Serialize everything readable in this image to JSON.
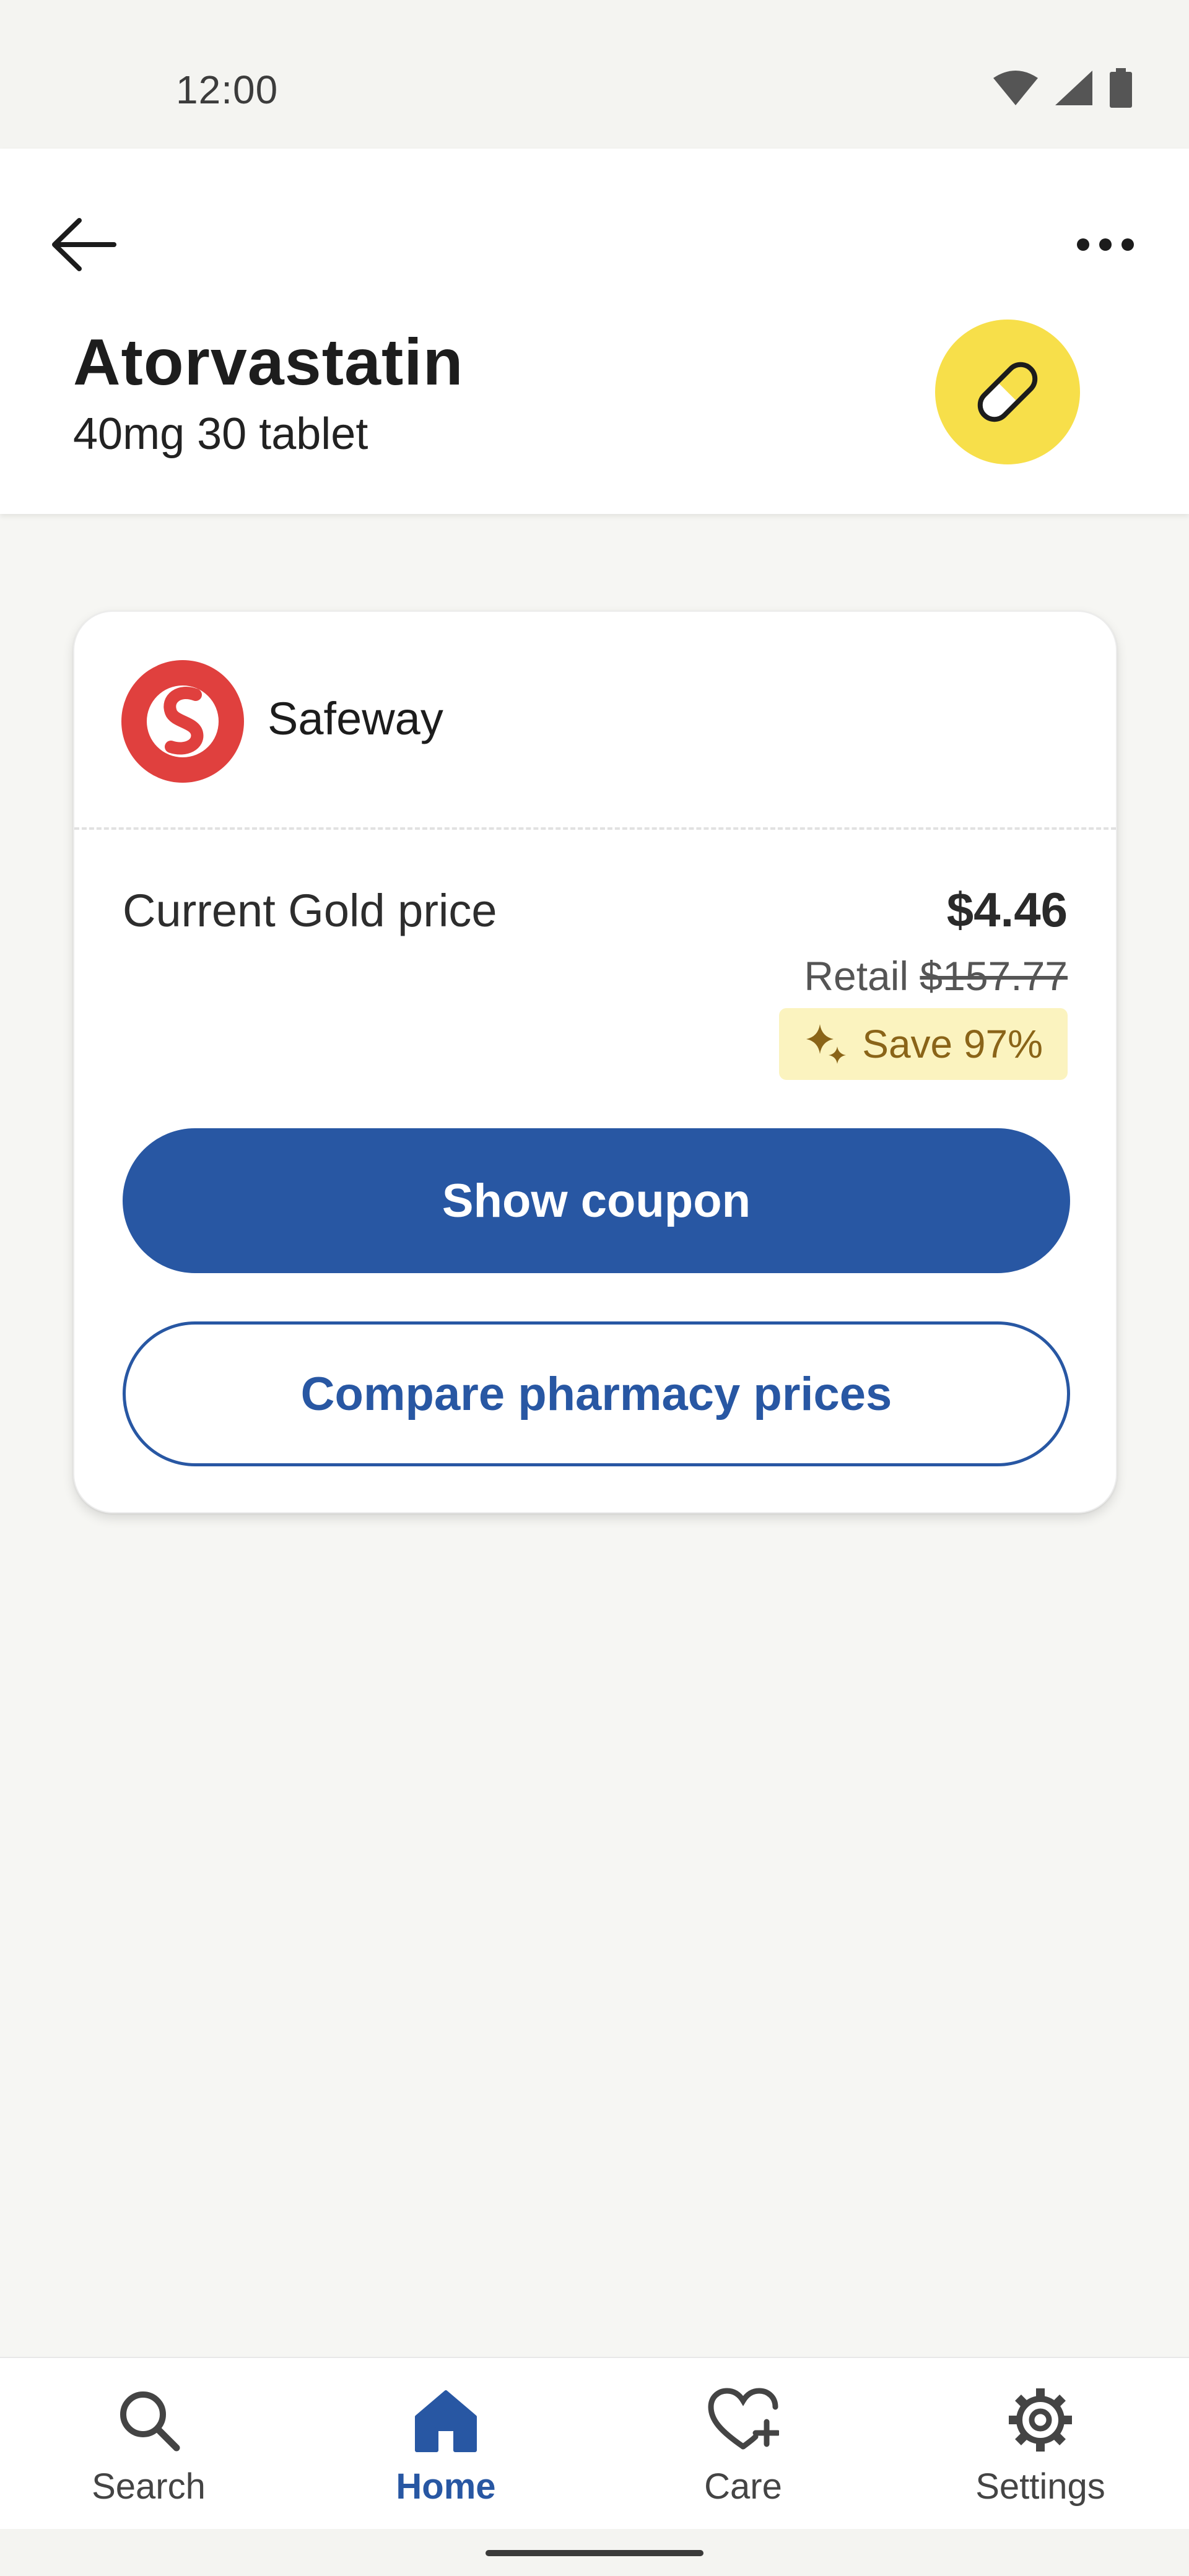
{
  "status_bar": {
    "time": "12:00",
    "icons": [
      "wifi-icon",
      "cellular-signal-icon",
      "battery-icon"
    ]
  },
  "header": {
    "back_icon": "arrow-left-icon",
    "more_icon": "more-horizontal-icon",
    "drug_name": "Atorvastatin",
    "drug_detail": "40mg 30 tablet",
    "badge_icon": "pill-icon"
  },
  "pharmacy_card": {
    "pharmacy_name": "Safeway",
    "price_label": "Current Gold price",
    "price": "$4.46",
    "retail_label": "Retail",
    "retail_price": "$157.77",
    "savings_label": "Save 97%",
    "primary_button": "Show coupon",
    "secondary_button": "Compare pharmacy prices"
  },
  "bottom_nav": {
    "items": [
      {
        "label": "Search",
        "icon": "search-icon",
        "active": false
      },
      {
        "label": "Home",
        "icon": "home-icon",
        "active": true
      },
      {
        "label": "Care",
        "icon": "heart-plus-icon",
        "active": false
      },
      {
        "label": "Settings",
        "icon": "gear-icon",
        "active": false
      }
    ]
  },
  "colors": {
    "primary": "#2857a3",
    "badge_yellow": "#f7df4a",
    "pharmacy_red": "#e0403e",
    "savings_bg": "#fbf3bf",
    "savings_text": "#8a6418"
  }
}
